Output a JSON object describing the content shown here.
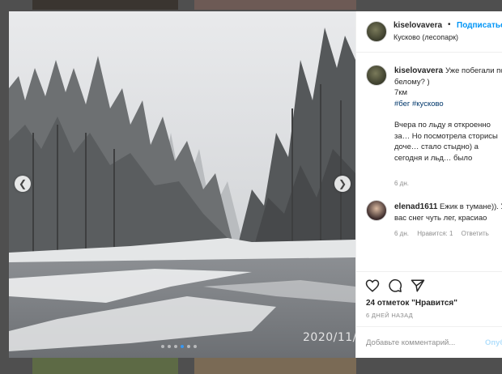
{
  "post": {
    "username": "kiselovavera",
    "follow_label": "Подписаться",
    "separator": "•",
    "location": "Кусково (лесопарк)",
    "photo_timestamp": "2020/11/",
    "carousel": {
      "total": 6,
      "active_index": 3
    }
  },
  "caption": {
    "username": "kiselovavera",
    "text_1": "Уже побегали по белому? )",
    "text_2": "7км",
    "tags": "#бег #кусково",
    "text_3": "Вчера по льду я откроенно за… Но посмотрела сторисы доче… стало стыдно) а сегодня и льд… было",
    "age": "6 дн."
  },
  "comment": {
    "username": "elenad1611",
    "text": "Ежик в тумане)). У вас снег чуть лег, красиао",
    "age": "6 дн.",
    "likes": "Нравится: 1",
    "reply": "Ответить"
  },
  "actions": {
    "likes_text": "24 отметок \"Нравится\"",
    "time_ago": "6 ДНЕЙ НАЗАД",
    "comment_placeholder": "Добавьте комментарий...",
    "post_label": "Опубликовать"
  },
  "icons": {
    "prev": "chevron-left-icon",
    "next": "chevron-right-icon",
    "like": "heart-icon",
    "comment": "speech-bubble-icon",
    "share": "paper-plane-icon"
  },
  "colors": {
    "link": "#0095f6",
    "hashtag": "#00376b",
    "active_dot": "#3897f0",
    "muted": "#8e8e8e"
  }
}
